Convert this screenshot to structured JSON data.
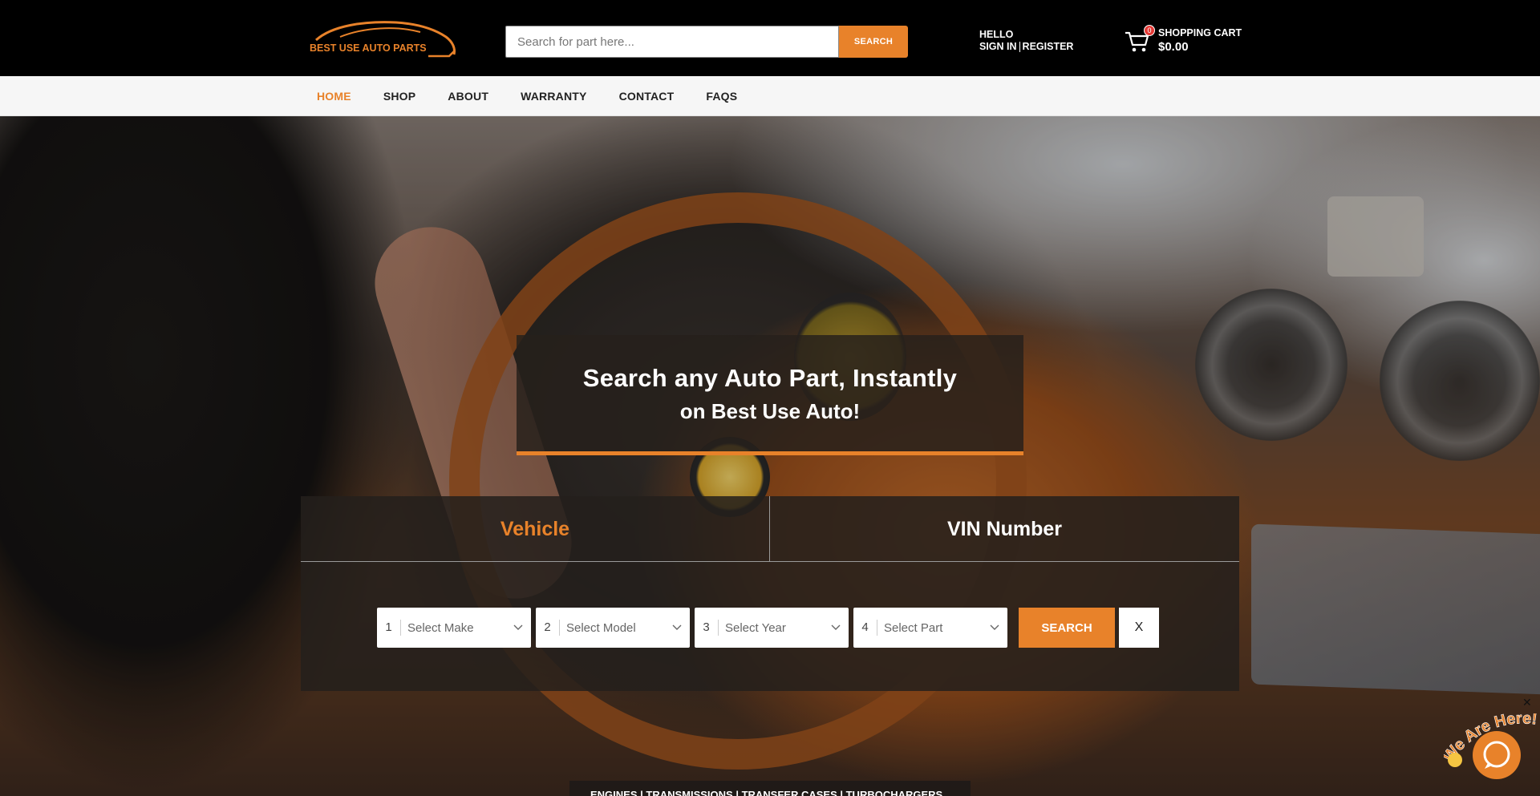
{
  "header": {
    "logo_text": "BEST USE AUTO PARTS",
    "search": {
      "placeholder": "Search for part here...",
      "button_label": "SEARCH"
    },
    "account": {
      "greeting": "HELLO",
      "sign_in": "SIGN IN",
      "register": "REGISTER"
    },
    "cart": {
      "count": "0",
      "title": "SHOPPING CART",
      "total": "$0.00"
    }
  },
  "nav": {
    "items": [
      {
        "label": "HOME",
        "active": true
      },
      {
        "label": "SHOP"
      },
      {
        "label": "ABOUT"
      },
      {
        "label": "WARRANTY"
      },
      {
        "label": "CONTACT"
      },
      {
        "label": "FAQS"
      }
    ]
  },
  "hero": {
    "headline": "Search any Auto Part, Instantly",
    "subheadline": "on Best Use Auto!"
  },
  "finder": {
    "tabs": [
      {
        "label": "Vehicle",
        "active": true
      },
      {
        "label": "VIN Number"
      }
    ],
    "selects": [
      {
        "number": "1",
        "label": "Select Make"
      },
      {
        "number": "2",
        "label": "Select Model"
      },
      {
        "number": "3",
        "label": "Select Year"
      },
      {
        "number": "4",
        "label": "Select Part"
      }
    ],
    "search_label": "SEARCH",
    "clear_label": "X"
  },
  "categories": "ENGINES | TRANSMISSIONS | TRANSFER CASES | TURBOCHARGERS",
  "chat": {
    "banner_text": "We Are Here!",
    "close_label": "✕"
  },
  "colors": {
    "accent": "#e8822a",
    "header_bg": "#000000",
    "nav_bg": "#f6f6f6"
  }
}
